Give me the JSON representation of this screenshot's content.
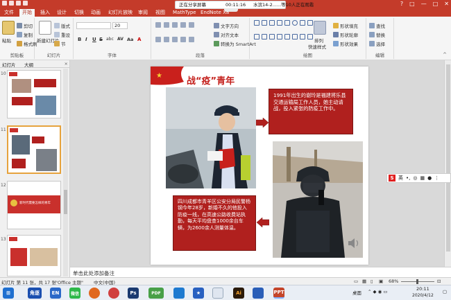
{
  "titlebar": {
    "window_buttons": [
      "?",
      "□",
      "—",
      "□",
      "✕"
    ]
  },
  "share": {
    "status": "正在分享屏幕",
    "timer": "00:11:16",
    "viewers": "水滨14-2......等10人正在观看"
  },
  "tabs": [
    "文件",
    "开始",
    "插入",
    "设计",
    "切换",
    "动画",
    "幻灯片放映",
    "审阅",
    "视图",
    "MathType",
    "EndNote X8"
  ],
  "ribbon": {
    "clipboard": {
      "paste": "粘贴",
      "cut": "剪切",
      "copy": "复制",
      "painter": "格式刷",
      "label": "剪贴板"
    },
    "slides": {
      "new_slide": "新建幻灯片",
      "layout": "版式",
      "reset": "重设",
      "section": "节",
      "label": "幻灯片"
    },
    "font": {
      "font_size": "20",
      "bold": "B",
      "italic": "I",
      "underline": "U",
      "strike": "S",
      "shadow": "abc",
      "spacing": "AV",
      "case": "Aa",
      "color": "A",
      "label": "字体"
    },
    "paragraph": {
      "text_dir": "文字方向",
      "align_text": "对齐文本",
      "smartart": "转换为 SmartArt",
      "label": "段落"
    },
    "drawing": {
      "arrange": "排列",
      "quick_styles": "快速样式",
      "fill": "形状填充",
      "outline": "形状轮廓",
      "effects": "形状效果",
      "label": "绘图"
    },
    "editing": {
      "find": "查找",
      "replace": "替换",
      "select": "选择",
      "label": "编辑"
    }
  },
  "left_panel": {
    "tab_slides": "幻灯片",
    "tab_outline": "大纲",
    "close": "×",
    "slides": [
      {
        "num": "10"
      },
      {
        "num": "11"
      },
      {
        "num": "12",
        "caption": "新时代需要怎样的青年"
      },
      {
        "num": "13"
      }
    ]
  },
  "slide": {
    "title": "战“疫”青年",
    "box1": "1991年出生的谢玲是福建将乐县交通运输局工作人员，她主动请战，投入紧张的防疫工作中。",
    "box2": "四川成都市青羊区公安分局民警杨钢今年28岁，新婚不久的他投入防疫一线，在高速公路收费站执勤，每天平均盘查1000余台车辆，为2600余人测量体温。"
  },
  "notes": {
    "placeholder": "单击此处添加备注"
  },
  "statusbar": {
    "slide_info": "幻灯片 第 11 张，共 17 张",
    "theme": "\"Office 主题\"",
    "language": "中文(中国)",
    "zoom": "68%"
  },
  "ime": {
    "mode": "英"
  },
  "taskbar": {
    "apps": [
      "角逐",
      "EN",
      "微信",
      "Ps",
      "PDF",
      "Ai",
      "PPT"
    ],
    "tray_desktop": "桌面",
    "time": "20:11",
    "date": "2020/4/12"
  },
  "colors": {
    "accent": "#c43b2a",
    "slide_red": "#b0201e"
  }
}
